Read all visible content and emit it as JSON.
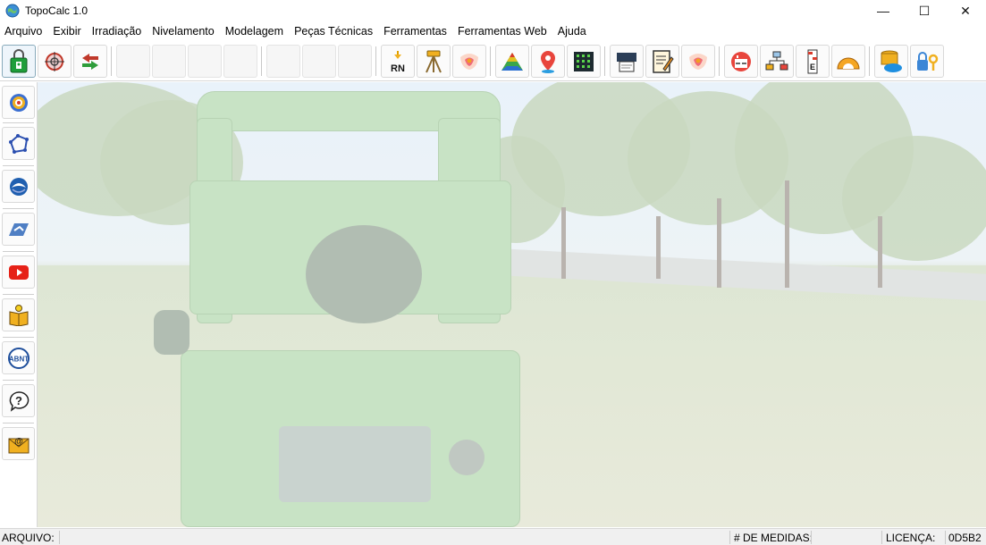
{
  "window": {
    "title": "TopoCalc 1.0",
    "controls": {
      "minimize": "—",
      "maximize": "☐",
      "close": "✕"
    }
  },
  "menubar": [
    {
      "label": "Arquivo"
    },
    {
      "label": "Exibir"
    },
    {
      "label": "Irradiação"
    },
    {
      "label": "Nivelamento"
    },
    {
      "label": "Modelagem"
    },
    {
      "label": "Peças Técnicas"
    },
    {
      "label": "Ferramentas"
    },
    {
      "label": "Ferramentas Web"
    },
    {
      "label": "Ajuda"
    }
  ],
  "toolbar": {
    "buttons": [
      {
        "icon": "license-lock-icon"
      },
      {
        "icon": "target-crosshair-icon"
      },
      {
        "icon": "swap-arrows-icon"
      },
      {
        "icon": "empty"
      },
      {
        "icon": "empty"
      },
      {
        "icon": "empty"
      },
      {
        "icon": "empty"
      },
      {
        "icon": "empty"
      },
      {
        "icon": "empty"
      },
      {
        "icon": "empty"
      },
      {
        "icon": "rn-benchmark-icon",
        "text": "RN"
      },
      {
        "icon": "tripod-level-icon"
      },
      {
        "icon": "orange-logo-icon"
      },
      {
        "icon": "terrain-model-icon"
      },
      {
        "icon": "map-pin-icon"
      },
      {
        "icon": "grid-points-icon"
      },
      {
        "icon": "plotter-print-icon"
      },
      {
        "icon": "document-edit-icon"
      },
      {
        "icon": "orange-logo-icon"
      },
      {
        "icon": "calculator-icon"
      },
      {
        "icon": "network-diagram-icon"
      },
      {
        "icon": "leveling-staff-icon",
        "text": "E"
      },
      {
        "icon": "protractor-icon"
      },
      {
        "icon": "cloud-database-icon"
      },
      {
        "icon": "key-lock-icon"
      }
    ]
  },
  "sidebar": {
    "buttons": [
      {
        "icon": "target-circle-icon"
      },
      {
        "icon": "polygon-icon"
      },
      {
        "icon": "noaa-icon"
      },
      {
        "icon": "shape-tool-icon"
      },
      {
        "icon": "youtube-icon"
      },
      {
        "icon": "manual-book-icon"
      },
      {
        "icon": "abnt-icon",
        "text": "ABNT"
      },
      {
        "icon": "help-question-icon",
        "text": "?"
      },
      {
        "icon": "email-icon",
        "text": "@"
      }
    ]
  },
  "statusbar": {
    "arquivo_label": "ARQUIVO:",
    "arquivo_value": "",
    "medidas_label": "# DE MEDIDAS:",
    "licenca_label": "LICENÇA:",
    "licenca_value": "0D5B2"
  },
  "colors": {
    "accent_green": "#1e9e3a",
    "accent_orange": "#f0a020",
    "accent_red": "#d9362b",
    "accent_blue": "#1f6fd1"
  }
}
